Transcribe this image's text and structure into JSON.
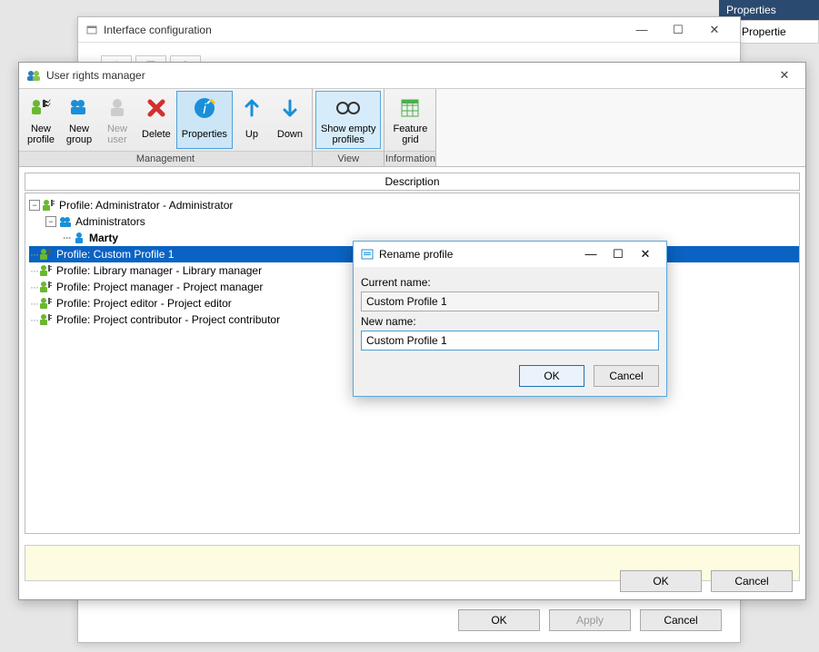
{
  "bgPanel": {
    "tab": "Properties",
    "row": "Propertie"
  },
  "ifaceWin": {
    "title": "Interface configuration",
    "buttons": {
      "ok": "OK",
      "apply": "Apply",
      "cancel": "Cancel"
    }
  },
  "urmWin": {
    "title": "User rights manager",
    "ribbon": {
      "management": {
        "label": "Management",
        "newProfile": "New\nprofile",
        "newGroup": "New\ngroup",
        "newUser": "New\nuser",
        "delete": "Delete",
        "properties": "Properties",
        "up": "Up",
        "down": "Down"
      },
      "view": {
        "label": "View",
        "showEmpty": "Show empty\nprofiles"
      },
      "information": {
        "label": "Information",
        "featureGrid": "Feature\ngrid"
      }
    },
    "descHeader": "Description",
    "tree": [
      {
        "level": 0,
        "expander": "-",
        "icon": "profile",
        "text": "Profile: Administrator - Administrator"
      },
      {
        "level": 1,
        "expander": "-",
        "icon": "group",
        "text": "Administrators"
      },
      {
        "level": 2,
        "expander": "",
        "icon": "user",
        "text": "Marty",
        "bold": true
      },
      {
        "level": 0,
        "expander": "",
        "icon": "profile",
        "text": "Profile: Custom Profile 1",
        "selected": true
      },
      {
        "level": 0,
        "expander": "",
        "icon": "profile",
        "text": "Profile: Library manager - Library manager"
      },
      {
        "level": 0,
        "expander": "",
        "icon": "profile",
        "text": "Profile: Project manager - Project manager"
      },
      {
        "level": 0,
        "expander": "",
        "icon": "profile",
        "text": "Profile: Project editor - Project editor"
      },
      {
        "level": 0,
        "expander": "",
        "icon": "profile",
        "text": "Profile: Project contributor - Project contributor"
      }
    ],
    "footer": {
      "ok": "OK",
      "cancel": "Cancel"
    }
  },
  "dialog": {
    "title": "Rename profile",
    "currentLabel": "Current name:",
    "currentValue": "Custom Profile 1",
    "newLabel": "New name:",
    "newValue": "Custom Profile 1",
    "ok": "OK",
    "cancel": "Cancel"
  }
}
